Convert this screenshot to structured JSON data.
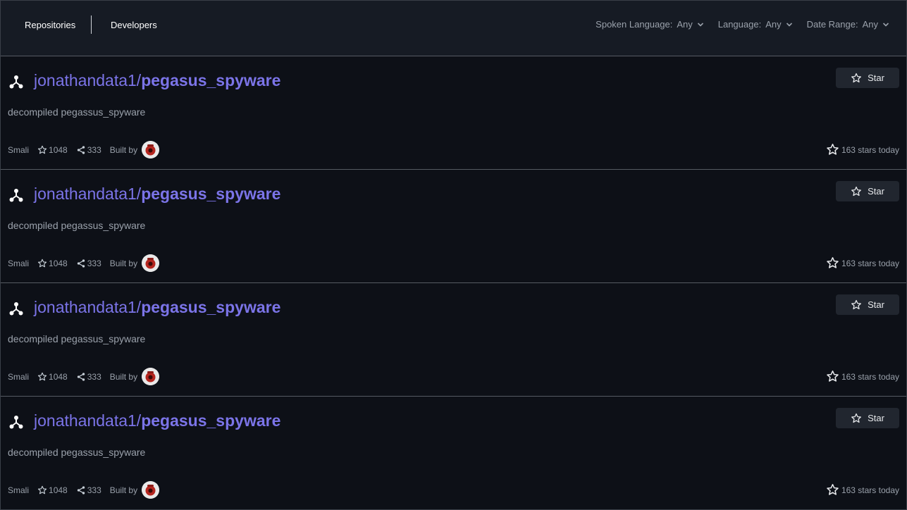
{
  "nav": {
    "repositories_label": "Repositories",
    "developers_label": "Developers"
  },
  "filters": [
    {
      "label": "Spoken Language:",
      "value": "Any"
    },
    {
      "label": "Language:",
      "value": "Any"
    },
    {
      "label": "Date Range:",
      "value": "Any"
    }
  ],
  "repos": [
    {
      "owner": "jonathandata1/",
      "name": "pegasus_spyware",
      "description": "decompiled pegassus_spyware",
      "language": "Smali",
      "stars": "1048",
      "forks": "333",
      "built_by_label": "Built by",
      "star_button_label": "Star",
      "stars_today": "163 stars today"
    },
    {
      "owner": "jonathandata1/",
      "name": "pegasus_spyware",
      "description": "decompiled pegassus_spyware",
      "language": "Smali",
      "stars": "1048",
      "forks": "333",
      "built_by_label": "Built by",
      "star_button_label": "Star",
      "stars_today": "163 stars today"
    },
    {
      "owner": "jonathandata1/",
      "name": "pegasus_spyware",
      "description": "decompiled pegassus_spyware",
      "language": "Smali",
      "stars": "1048",
      "forks": "333",
      "built_by_label": "Built by",
      "star_button_label": "Star",
      "stars_today": "163 stars today"
    },
    {
      "owner": "jonathandata1/",
      "name": "pegasus_spyware",
      "description": "decompiled pegassus_spyware",
      "language": "Smali",
      "stars": "1048",
      "forks": "333",
      "built_by_label": "Built by",
      "star_button_label": "Star",
      "stars_today": "163 stars today"
    }
  ],
  "colors": {
    "background": "#0d1017",
    "header": "#161b24",
    "link": "#7b74e8",
    "muted_text": "#9aa1ab"
  },
  "icons": {
    "repo": "fork-icon",
    "star": "star-icon",
    "fork_count": "share-icon",
    "chevron": "chevron-down-icon"
  }
}
